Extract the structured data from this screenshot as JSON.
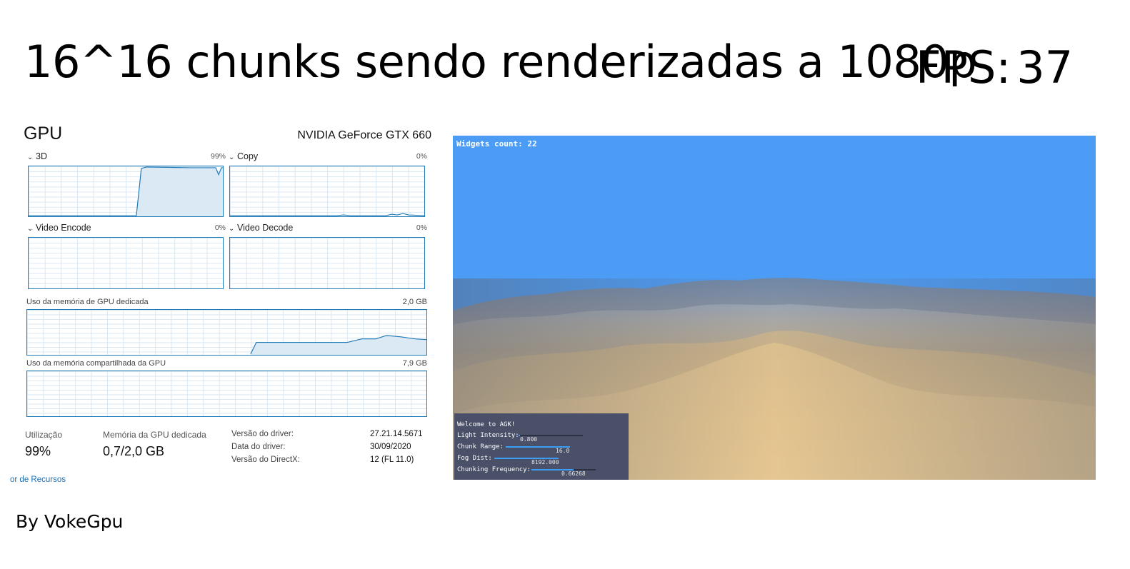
{
  "headline": "16^16 chunks sendo renderizadas a 1080p",
  "fps": {
    "label": "FPS:",
    "value": "37"
  },
  "task_manager": {
    "title": "GPU",
    "gpu_name": "NVIDIA GeForce GTX 660",
    "engines": [
      {
        "label": "3D",
        "percent": "99%"
      },
      {
        "label": "Copy",
        "percent": "0%"
      },
      {
        "label": "Video Encode",
        "percent": "0%"
      },
      {
        "label": "Video Decode",
        "percent": "0%"
      }
    ],
    "dedicated_memory": {
      "label": "Uso da memória de GPU dedicada",
      "max": "2,0 GB"
    },
    "shared_memory": {
      "label": "Uso da memória compartilhada da GPU",
      "max": "7,9 GB"
    },
    "stats": {
      "utilization_label": "Utilização",
      "utilization_value": "99%",
      "dedicated_label": "Memória da GPU dedicada",
      "dedicated_value": "0,7/2,0 GB"
    },
    "details": [
      {
        "key": "Versão do driver:",
        "value": "27.21.14.5671"
      },
      {
        "key": "Data do driver:",
        "value": "30/09/2020"
      },
      {
        "key": "Versão do DirectX:",
        "value": "12 (FL 11.0)"
      }
    ],
    "link": "or de Recursos"
  },
  "game": {
    "widgets_count": "Widgets count: 22",
    "panel": {
      "title": "Welcome to AGK!",
      "sliders": [
        {
          "label": "Light Intensity:",
          "value": "0.800",
          "fill": 0.02
        },
        {
          "label": "Chunk Range:",
          "value": "16.0",
          "fill": 1.0
        },
        {
          "label": "Fog Dist:",
          "value": "8192.000",
          "fill": 1.0
        },
        {
          "label": "Chunking Frequency:",
          "value": "0.66268",
          "fill": 0.66
        }
      ]
    },
    "colors": {
      "sky": "#4c9cf5",
      "panel": "#4a5067",
      "slider": "#3d9df5"
    }
  },
  "byline": "By VokeGpu"
}
